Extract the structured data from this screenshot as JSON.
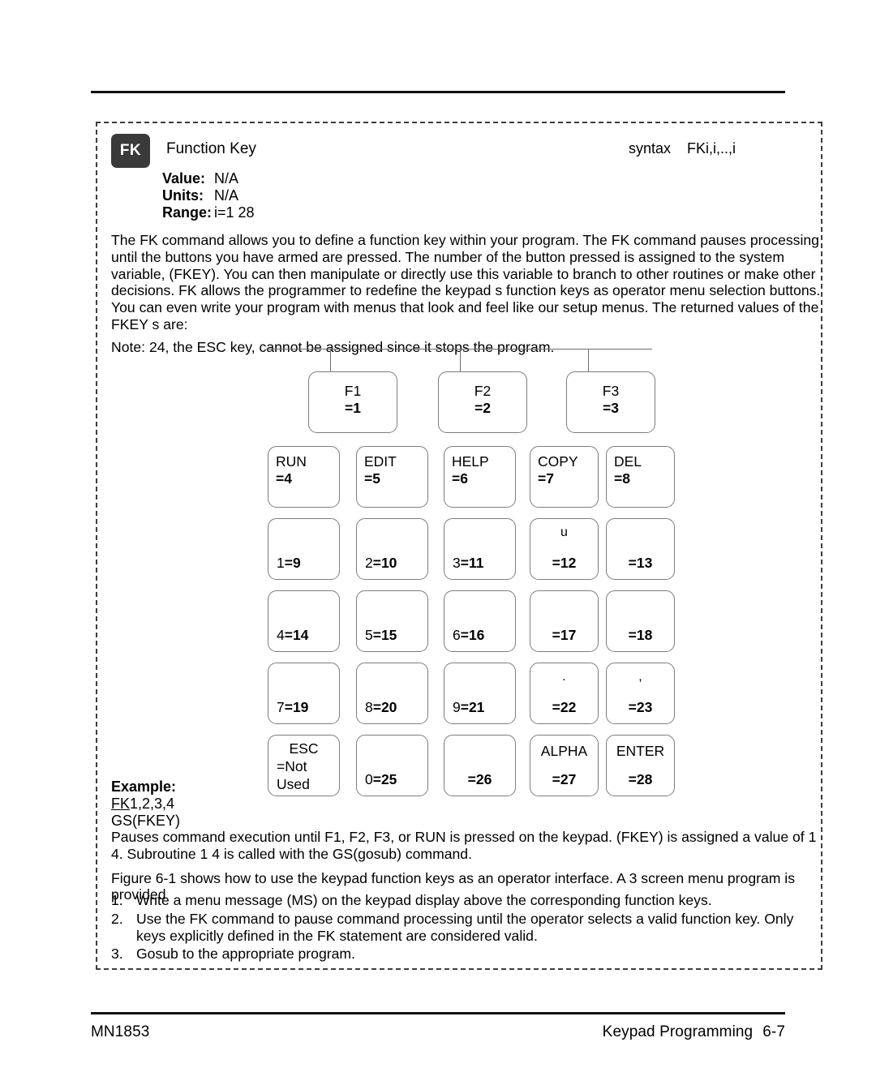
{
  "header": {
    "rule_top": true,
    "badge": "FK",
    "title": "Function Key",
    "syntax_label": "syntax",
    "syntax_value": "FKi,i,..,i"
  },
  "spec": {
    "rows": [
      {
        "key": "Value:",
        "value": "N/A"
      },
      {
        "key": "Units:",
        "value": "N/A"
      },
      {
        "key": "Range:",
        "value": "i=1  28"
      }
    ]
  },
  "description": {
    "body": "The FK command allows you to define a function key within your program. The FK command pauses processing until the buttons you have  armed  are pressed. The number of the button pressed is assigned to the system variable, (FKEY). You can then manipulate or directly use this variable to branch to other routines or make other decisions. FK allows the programmer to redefine the keypad s function keys as operator menu selection buttons. You can even write your program with menus that look and feel like our setup menus.  The returned values of the FKEY s are:",
    "note": "Note:  24, the ESC key, cannot be assigned since it stops the program."
  },
  "keypad": {
    "fkeys": [
      {
        "label": "F1",
        "value": "=1"
      },
      {
        "label": "F2",
        "value": "=2"
      },
      {
        "label": "F3",
        "value": "=3"
      }
    ],
    "named_row": [
      {
        "label": "RUN",
        "value": "=4"
      },
      {
        "label": "EDIT",
        "value": "=5"
      },
      {
        "label": "HELP",
        "value": "=6"
      },
      {
        "label": "COPY",
        "value": "=7"
      },
      {
        "label": "DEL",
        "value": "=8"
      }
    ],
    "row_9_13": [
      {
        "label": "1",
        "value": "=9",
        "glyph": ""
      },
      {
        "label": "2",
        "value": "=10",
        "glyph": ""
      },
      {
        "label": "3",
        "value": "=11",
        "glyph": ""
      },
      {
        "label": "",
        "value": "=12",
        "glyph": "u"
      },
      {
        "label": "",
        "value": "=13",
        "glyph": ""
      }
    ],
    "row_14_18": [
      {
        "label": "4",
        "value": "=14",
        "glyph": ""
      },
      {
        "label": "5",
        "value": "=15",
        "glyph": ""
      },
      {
        "label": "6",
        "value": "=16",
        "glyph": ""
      },
      {
        "label": "",
        "value": "=17",
        "glyph": ""
      },
      {
        "label": "",
        "value": "=18",
        "glyph": ""
      }
    ],
    "row_19_23": [
      {
        "label": "7",
        "value": "=19",
        "glyph": ""
      },
      {
        "label": "8",
        "value": "=20",
        "glyph": ""
      },
      {
        "label": "9",
        "value": "=21",
        "glyph": ""
      },
      {
        "label": "",
        "value": "=22",
        "glyph": "."
      },
      {
        "label": "",
        "value": "=23",
        "glyph": ","
      }
    ],
    "row_bottom": [
      {
        "label": "ESC",
        "value": "=Not",
        "value2": "Used"
      },
      {
        "label": "0",
        "value": "=25"
      },
      {
        "label": "",
        "value": "=26"
      },
      {
        "label": "ALPHA",
        "value": "=27"
      },
      {
        "label": "ENTER",
        "value": "=28"
      }
    ]
  },
  "example": {
    "title": "Example:",
    "line1_underlined": "FK",
    "line1_rest": "1,2,3,4",
    "line2": "GS(FKEY)"
  },
  "after": {
    "para1": "Pauses command execution until F1, F2, F3, or RUN is pressed on the keypad. (FKEY) is assigned a value of 1  4. Subroutine 1  4 is called with the GS(gosub) command.",
    "para2": "Figure 6-1 shows how to use the keypad function keys as an operator interface. A 3  screen menu program is provided"
  },
  "steps": [
    {
      "n": "1.",
      "text": "Write a menu message (MS) on the keypad display above the corresponding function keys."
    },
    {
      "n": "2.",
      "text": "Use the FK command to pause command processing until the operator selects a valid function key. Only keys explicitly defined in the FK statement are considered valid."
    },
    {
      "n": "3.",
      "text": "Gosub to the appropriate program."
    }
  ],
  "footer": {
    "left": "MN1853",
    "section": "Keypad Programming",
    "page": "6-7"
  }
}
